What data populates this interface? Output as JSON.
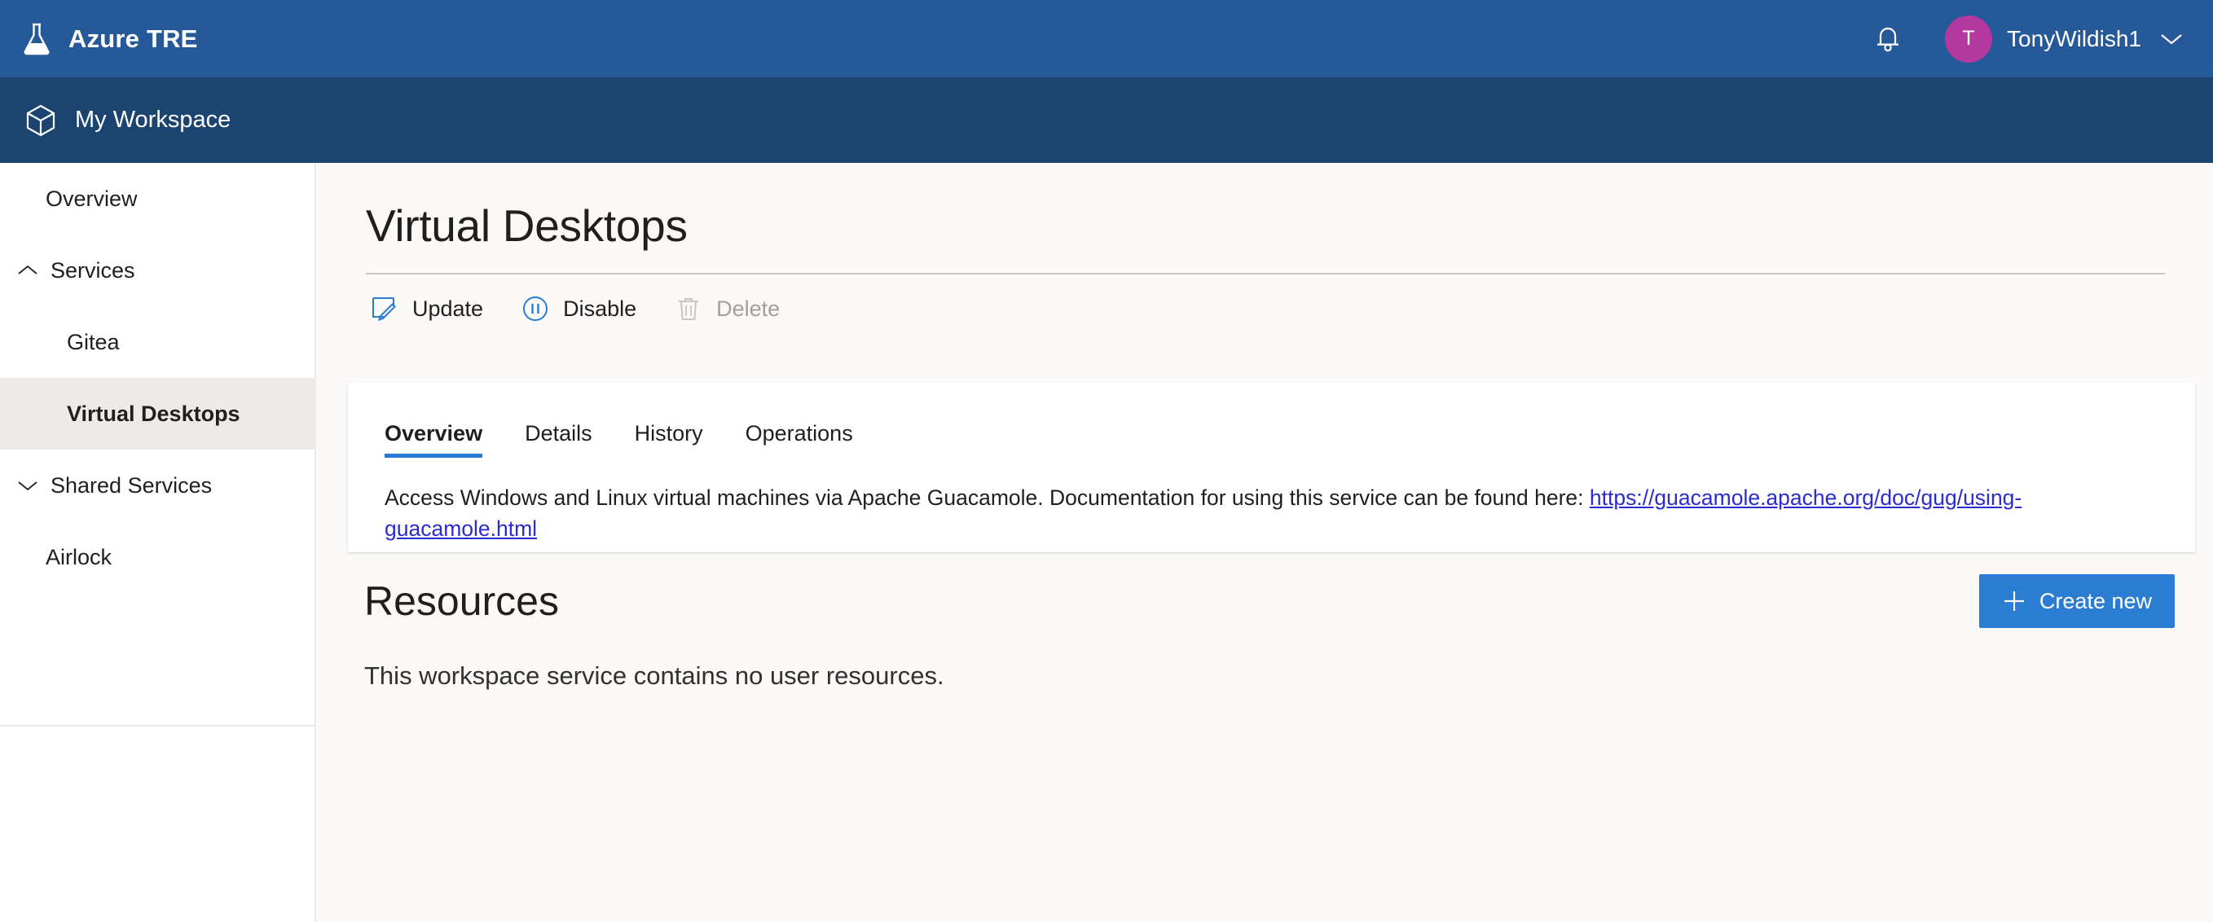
{
  "topbar": {
    "brand_icon": "flask-icon",
    "brand_title": "Azure TRE",
    "bell_icon": "notification-bell-icon",
    "avatar_initial": "T",
    "avatar_color": "#B4399E",
    "user_name": "TonyWildish1",
    "chevron_icon": "chevron-down-icon",
    "bg_color": "#25599A"
  },
  "workspacebar": {
    "icon": "cube-icon",
    "title": "My Workspace",
    "bg_color": "#1B4470"
  },
  "sidebar": {
    "items": [
      {
        "label": "Overview",
        "level": "plain",
        "caret": "",
        "selected": false
      },
      {
        "label": "Services",
        "level": "root",
        "caret": "chevron-up-icon",
        "selected": false
      },
      {
        "label": "Gitea",
        "level": "child",
        "caret": "",
        "selected": false
      },
      {
        "label": "Virtual Desktops",
        "level": "child",
        "caret": "",
        "selected": true
      },
      {
        "label": "Shared Services",
        "level": "root",
        "caret": "chevron-down-icon",
        "selected": false
      },
      {
        "label": "Airlock",
        "level": "plain",
        "caret": "",
        "selected": false
      }
    ]
  },
  "main": {
    "page_title": "Virtual Desktops",
    "commands": [
      {
        "label": "Update",
        "icon": "edit-pencil-icon",
        "disabled": false
      },
      {
        "label": "Disable",
        "icon": "pause-circle-icon",
        "disabled": false
      },
      {
        "label": "Delete",
        "icon": "trash-icon",
        "disabled": true
      }
    ],
    "tabs": [
      {
        "label": "Overview",
        "active": true
      },
      {
        "label": "Details",
        "active": false
      },
      {
        "label": "History",
        "active": false
      },
      {
        "label": "Operations",
        "active": false
      }
    ],
    "overview_text_before": "Access Windows and Linux virtual machines via Apache Guacamole. Documentation for using this service can be found here: ",
    "overview_link_text": "https://guacamole.apache.org/doc/gug/using-guacamole.html",
    "resources_title": "Resources",
    "create_button_label": "Create new",
    "create_button_icon": "plus-icon",
    "resources_empty_text": "This workspace service contains no user resources.",
    "accent_color": "#2B7CD3"
  }
}
